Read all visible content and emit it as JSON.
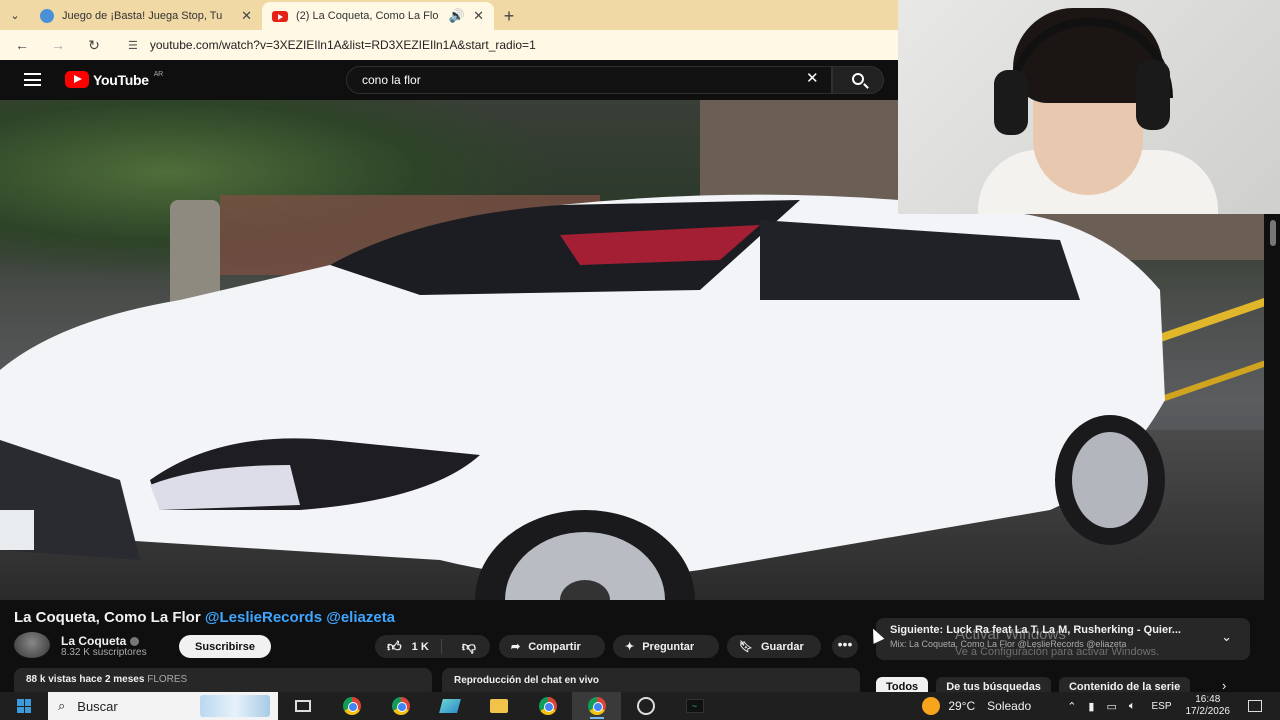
{
  "browser": {
    "tabs": [
      {
        "title": "Juego de ¡Basta! Juega Stop, Tu",
        "active": false
      },
      {
        "title": "(2) La Coqueta, Como La Flo",
        "active": true
      }
    ],
    "url": "youtube.com/watch?v=3XEZIEIln1A&list=RD3XEZIEIln1A&start_radio=1"
  },
  "youtube": {
    "logo_text": "YouTube",
    "region": "AR",
    "search_value": "cono la flor"
  },
  "video": {
    "title": "La Coqueta, Como La Flor",
    "title_tags": "@LeslieRecords @eliazeta",
    "channel": "La Coqueta",
    "subscribers": "8.32 K suscriptores",
    "subscribe_label": "Suscribirse",
    "likes": "1 K",
    "share_label": "Compartir",
    "ask_label": "Preguntar",
    "save_label": "Guardar",
    "more_label": "•••",
    "views_line": "88 k vistas  hace 2 meses",
    "category": "FLORES",
    "chat_label": "Reproducción del chat en vivo"
  },
  "next_up": {
    "title": "Siguiente: Luck Ra feat La T, La M, Rusherking - Quier...",
    "subtitle": "Mix: La Coqueta, Como La Flor @LeslieRecords @eliazeta"
  },
  "watermark": {
    "line1": "Activar Windows",
    "line2": "Ve a Configuración para activar Windows."
  },
  "chips": [
    "Todos",
    "De tus búsquedas",
    "Contenido de la serie"
  ],
  "taskbar": {
    "search_placeholder": "Buscar",
    "temperature": "29°C",
    "condition": "Soleado",
    "language": "ESP",
    "time": "16:48",
    "date": "17/2/2026"
  }
}
